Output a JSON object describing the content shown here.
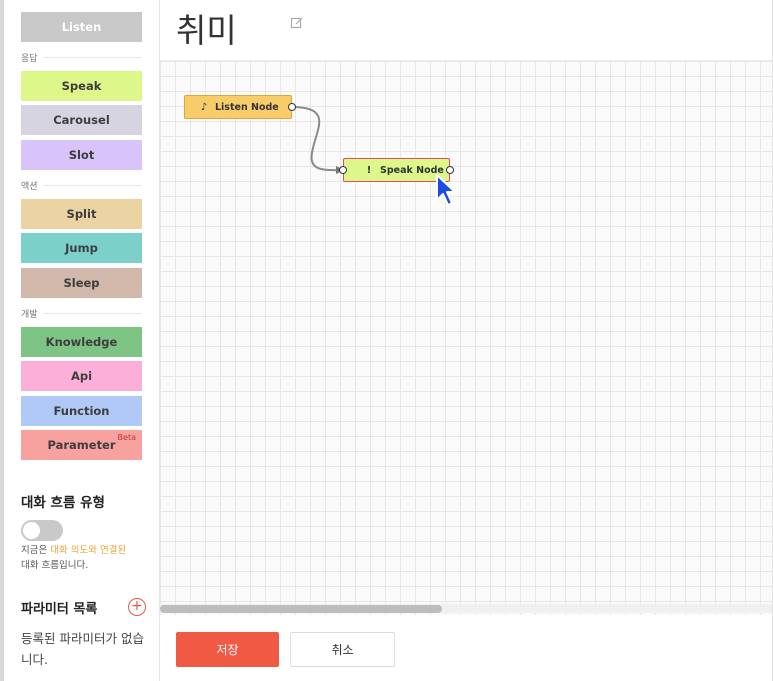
{
  "palette": {
    "top": {
      "label": "Listen",
      "color": "#c8c8c8",
      "text_color": "#ffffff"
    },
    "sections": [
      {
        "label": "응답",
        "items": [
          {
            "label": "Speak",
            "color": "#ddf78a"
          },
          {
            "label": "Carousel",
            "color": "#d6d4e0"
          },
          {
            "label": "Slot",
            "color": "#d8c4fb"
          }
        ]
      },
      {
        "label": "액션",
        "items": [
          {
            "label": "Split",
            "color": "#ecd3a4"
          },
          {
            "label": "Jump",
            "color": "#7bd1ca"
          },
          {
            "label": "Sleep",
            "color": "#d2b7ab"
          }
        ]
      },
      {
        "label": "개발",
        "items": [
          {
            "label": "Knowledge",
            "color": "#7ec485"
          },
          {
            "label": "Api",
            "color": "#fbafd9"
          },
          {
            "label": "Function",
            "color": "#b0c9f7"
          },
          {
            "label": "Parameter",
            "color": "#f8a2a0",
            "badge": "Beta"
          }
        ]
      }
    ]
  },
  "flow_type": {
    "title": "대화 흐름 유형",
    "toggle_on": false,
    "desc_prefix": "지금은 ",
    "desc_highlight": "대화 의도와 연결된",
    "desc_suffix": "대화 흐름입니다."
  },
  "parameters": {
    "title": "파라미터 목록",
    "add_symbol": "+",
    "empty_text": "등록된 파라미터가 없습니다."
  },
  "header": {
    "title": "취미"
  },
  "canvas": {
    "nodes": [
      {
        "label": "Listen Node",
        "icon": "ear-icon",
        "color": "#f9cc6a",
        "border": "#d6a640"
      },
      {
        "label": "Speak Node",
        "icon": "speak-icon",
        "color": "#ddf78a",
        "border": "#e04a5f"
      }
    ],
    "scroll_fraction": 0.46
  },
  "footer": {
    "save_label": "저장",
    "cancel_label": "취소"
  }
}
